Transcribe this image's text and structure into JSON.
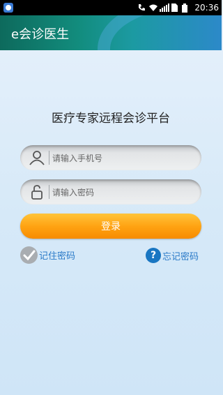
{
  "status_bar": {
    "time": "20:36",
    "icons": [
      "app-notification-icon",
      "phone-icon",
      "wifi-icon",
      "signal-icon",
      "sim-icon",
      "battery-icon"
    ]
  },
  "app_bar": {
    "title": "e会诊医生"
  },
  "main": {
    "title": "医疗专家远程会诊平台",
    "phone_input": {
      "placeholder": "请输入手机号",
      "value": ""
    },
    "password_input": {
      "placeholder": "请输入密码",
      "value": ""
    },
    "login_button_label": "登录",
    "remember_label": "记住密码",
    "forgot_label": "忘记密码",
    "forgot_icon_glyph": "?"
  },
  "colors": {
    "accent_orange": "#ffa313",
    "link_blue": "#2a7ac8",
    "app_bar_teal": "#128c7d"
  }
}
